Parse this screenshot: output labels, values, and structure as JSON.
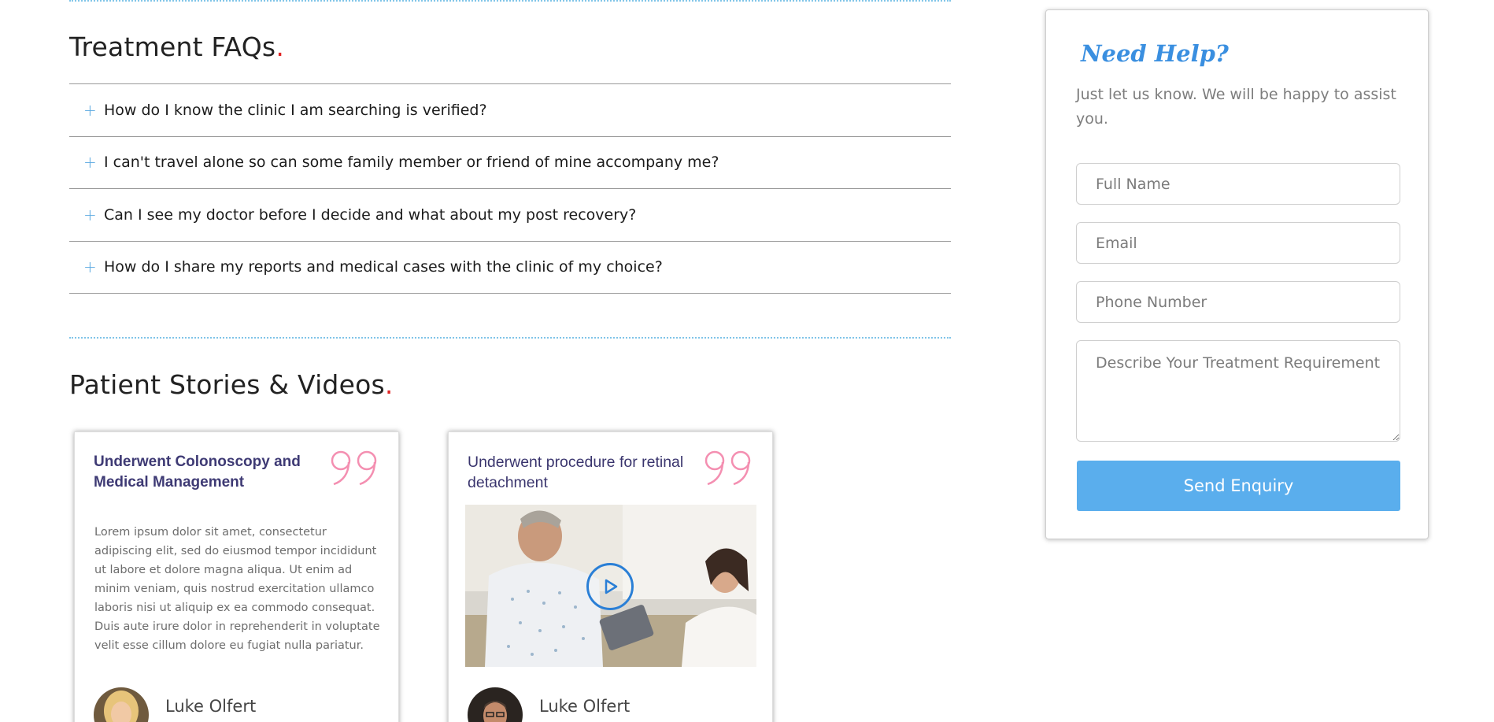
{
  "faq": {
    "title": "Treatment FAQs",
    "title_dot": ".",
    "items": [
      {
        "question": "How do I know the clinic I am searching is verified?"
      },
      {
        "question": "I can't travel alone so can some family member or friend of mine accompany me?"
      },
      {
        "question": "Can I see my doctor before I decide and what about my post recovery?"
      },
      {
        "question": "How do I share my reports and medical cases with the clinic of my choice?"
      }
    ],
    "expand_symbol": "+"
  },
  "stories": {
    "title": "Patient Stories & Videos",
    "title_dot": ".",
    "cards": [
      {
        "title": "Underwent Colonoscopy and Medical Management",
        "text": "Lorem ipsum dolor sit amet, consectetur adipiscing elit, sed do eiusmod tempor incididunt ut labore et dolore magna aliqua. Ut enim ad minim veniam, quis nostrud exercitation ullamco laboris nisi ut aliquip ex ea commodo consequat. Duis aute irure dolor in reprehenderit in voluptate velit esse cillum dolore eu fugiat nulla pariatur.",
        "author": "Luke Olfert"
      },
      {
        "title": "Underwent procedure for retinal detachment",
        "author": "Luke Olfert"
      }
    ]
  },
  "help": {
    "title": "Need Help?",
    "subtitle": "Just let us know. We will be happy to assist you.",
    "fields": {
      "full_name": "Full Name",
      "email": "Email",
      "phone": "Phone Number",
      "requirement": "Describe Your Treatment Requirement"
    },
    "button": "Send Enquiry"
  },
  "colors": {
    "accent_blue": "#5aaeed",
    "title_blue": "#3a8fe0",
    "dot_red": "#e02424",
    "quote_pink": "#f48fb1",
    "card_title": "#2a2566"
  }
}
